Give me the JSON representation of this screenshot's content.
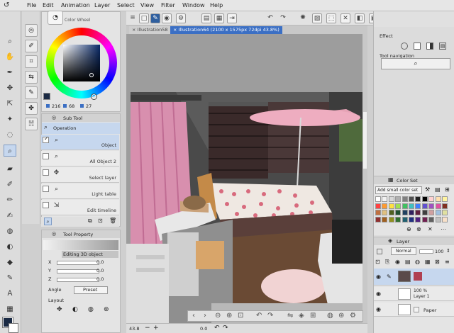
{
  "menu": {
    "items": [
      "File",
      "Edit",
      "Animation",
      "Layer",
      "Select",
      "View",
      "Filter",
      "Window",
      "Help"
    ]
  },
  "color_wheel": {
    "title": "Color Wheel",
    "values": [
      "216",
      "68",
      "27"
    ],
    "main_color": "#1a2a44",
    "sub_color": "#ffffff"
  },
  "sub_tool": {
    "title": "Sub Tool",
    "group": "Operation",
    "items": [
      {
        "label": "Object"
      },
      {
        "label": "All Object 2"
      },
      {
        "label": "Select layer"
      },
      {
        "label": "Light table"
      },
      {
        "label": "Edit timeline"
      }
    ]
  },
  "tool_property": {
    "title": "Tool Property",
    "subtitle": "Editing 3D object",
    "rows": [
      {
        "axis": "X",
        "value": "0.0"
      },
      {
        "axis": "Y",
        "value": "0.0"
      },
      {
        "axis": "Z",
        "value": "0.0"
      }
    ],
    "angle_label": "Angle",
    "preset_label": "Preset",
    "layout_label": "Layout"
  },
  "tabs": [
    {
      "label": "Illustration58"
    },
    {
      "label": "Illustration64 (2100 x 1575px 72dpi 43.8%)"
    }
  ],
  "status": {
    "zoom": "43.8",
    "angle": "0.0"
  },
  "right": {
    "effect_label": "Effect",
    "tool_nav_label": "Tool navigation",
    "color_set_title": "Color Set",
    "color_set_name": "Add small color set",
    "layer_title": "Layer",
    "blend_mode": "Normal",
    "opacity": "100",
    "layers": [
      {
        "name": "",
        "opacity": "",
        "selected": true
      },
      {
        "name": "Layer 1",
        "opacity": "100 %",
        "selected": false
      },
      {
        "name": "Paper",
        "opacity": "",
        "selected": false
      }
    ]
  },
  "colors": {
    "accent": "#2f5f9f",
    "selected_row": "#c6d7ee",
    "tab_active": "#3b6fc4"
  }
}
